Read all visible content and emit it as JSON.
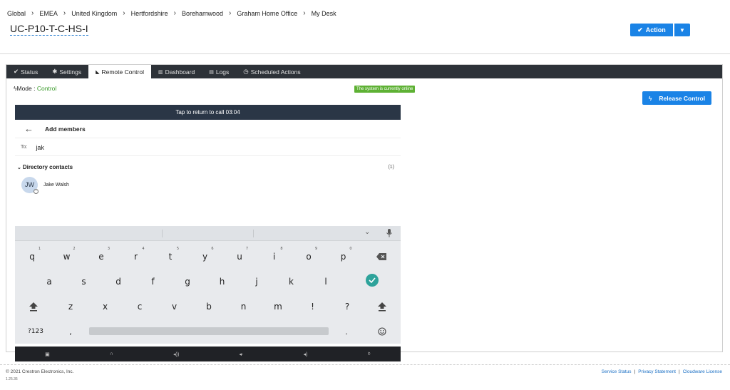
{
  "breadcrumb": [
    "Global",
    "EMEA",
    "United Kingdom",
    "Hertfordshire",
    "Borehamwood",
    "Graham Home Office",
    "My Desk"
  ],
  "device_name": "UC-P10-T-C-HS-I",
  "action_button": {
    "label": "Action",
    "icon": "check-icon"
  },
  "tabs": [
    {
      "label": "Status",
      "icon": "check-icon"
    },
    {
      "label": "Settings",
      "icon": "gear-icon"
    },
    {
      "label": "Remote Control",
      "icon": "signal-icon"
    },
    {
      "label": "Dashboard",
      "icon": "bar-chart-icon"
    },
    {
      "label": "Logs",
      "icon": "list-icon"
    },
    {
      "label": "Scheduled Actions",
      "icon": "clock-icon"
    }
  ],
  "mode": {
    "label": "Mode : ",
    "value": "Control"
  },
  "online_badge": "The system is currently online",
  "release_button": {
    "label": "Release Control",
    "icon": "bolt-icon"
  },
  "screen": {
    "call_bar": "Tap to return to call 03:04",
    "title": "Add members",
    "to_label": "To:",
    "to_value": "jak",
    "directory_label": "Directory contacts",
    "directory_count": "(1)",
    "contact": {
      "initials": "JW",
      "name": "Jake Walsh"
    }
  },
  "keyboard": {
    "row1": [
      {
        "k": "q",
        "n": "1"
      },
      {
        "k": "w",
        "n": "2"
      },
      {
        "k": "e",
        "n": "3"
      },
      {
        "k": "r",
        "n": "4"
      },
      {
        "k": "t",
        "n": "5"
      },
      {
        "k": "y",
        "n": "6"
      },
      {
        "k": "u",
        "n": "7"
      },
      {
        "k": "i",
        "n": "8"
      },
      {
        "k": "o",
        "n": "9"
      },
      {
        "k": "p",
        "n": "0"
      }
    ],
    "row2": [
      "a",
      "s",
      "d",
      "f",
      "g",
      "h",
      "j",
      "k",
      "l"
    ],
    "row3": [
      "z",
      "x",
      "c",
      "v",
      "b",
      "n",
      "m",
      "!",
      "?"
    ],
    "bottom": {
      "symbols": "?123",
      "comma": ",",
      "period": "."
    }
  },
  "footer": {
    "copyright": "© 2021 Crestron Electronics, Inc.",
    "version": "1.25.36",
    "links": [
      "Service Status",
      "Privacy Statement",
      "Cloudware License"
    ]
  },
  "colors": {
    "accent": "#1a83e6",
    "tabbar": "#2d3238",
    "online": "#5eb134",
    "call_bar": "#2a3646"
  }
}
